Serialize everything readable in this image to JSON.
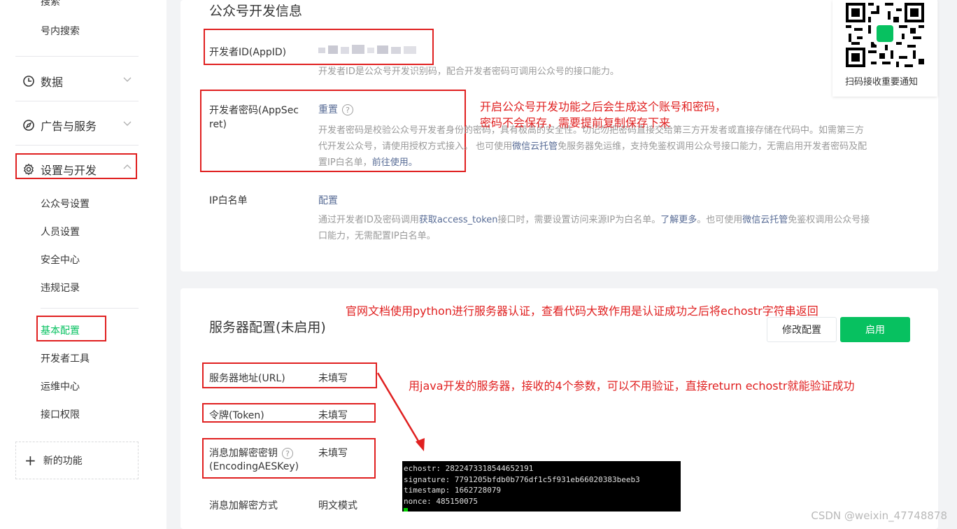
{
  "sidebar": {
    "top_item": "搜索",
    "search_item": "号内搜索",
    "data_label": "数据",
    "ads_label": "广告与服务",
    "settings_label": "设置与开发",
    "settings_items": [
      "公众号设置",
      "人员设置",
      "安全中心",
      "违规记录"
    ],
    "dev_items": [
      "基本配置",
      "开发者工具",
      "运维中心",
      "接口权限"
    ],
    "new_features": "新的功能"
  },
  "dev_info": {
    "title": "公众号开发信息",
    "appid_label": "开发者ID(AppID)",
    "appid_desc": "开发者ID是公众号开发识别码，配合开发者密码可调用公众号的接口能力。",
    "secret_label_1": "开发者密码(AppSec",
    "secret_label_2": "ret)",
    "reset_link": "重置",
    "secret_desc_1": "开发者密码是校验公众号开发者身份的密码，具有极高的安全性。切记勿把密码直接交给第三方开发者或直接存储在代码中。如需第三方",
    "secret_desc_2a": "代开发公众号，请使用授权方式接入。 也可使用",
    "secret_desc_2b": "微信云托管",
    "secret_desc_2c": "免服务器免运维，支持免鉴权调用公众号接口能力，无需启用开发者密码及配",
    "secret_desc_3a": "置IP白名单，",
    "secret_desc_3b": "前往使用。",
    "ip_label": "IP白名单",
    "ip_config_link": "配置",
    "ip_desc_1a": "通过开发者ID及密码调用",
    "ip_desc_1b": "获取access_token",
    "ip_desc_1c": "接口时，需要设置访问来源IP为白名单。",
    "ip_desc_1d": "了解更多",
    "ip_desc_1e": "。也可使用",
    "ip_desc_1f": "微信云托管",
    "ip_desc_1g": "免鉴权调用公众号接",
    "ip_desc_2": "口能力，无需配置IP白名单。"
  },
  "qr": {
    "caption": "扫码接收重要通知"
  },
  "server": {
    "title": "服务器配置(未启用)",
    "modify_button": "修改配置",
    "enable_button": "启用",
    "url_label": "服务器地址(URL)",
    "url_value": "未填写",
    "token_label": "令牌(Token)",
    "token_value": "未填写",
    "aes_label_1": "消息加解密密钥",
    "aes_label_2": "(EncodingAESKey)",
    "aes_value": "未填写",
    "mode_label": "消息加解密方式",
    "mode_value": "明文模式"
  },
  "annotations": {
    "note1_line1": "开启公众号开发功能之后会生成这个账号和密码，",
    "note1_line2": "密码不会保存，需要提前复制保存下来",
    "note2": "官网文档使用python进行服务器认证，查看代码大致作用是认证成功之后将echostr字符串返回",
    "note3": "用java开发的服务器，接收的4个参数，可以不用验证，直接return echostr就能验证成功"
  },
  "terminal": {
    "lines": [
      "echostr: 2822473318544652191",
      "signature: 7791205bfdb0b776df1c5f931eb66020383beeb3",
      "timestamp: 1662728079",
      "nonce: 485150075"
    ]
  },
  "watermark": "CSDN @weixin_47748878",
  "colors": {
    "accent": "#07c160",
    "annotation": "#e02020",
    "link": "#576b95"
  }
}
